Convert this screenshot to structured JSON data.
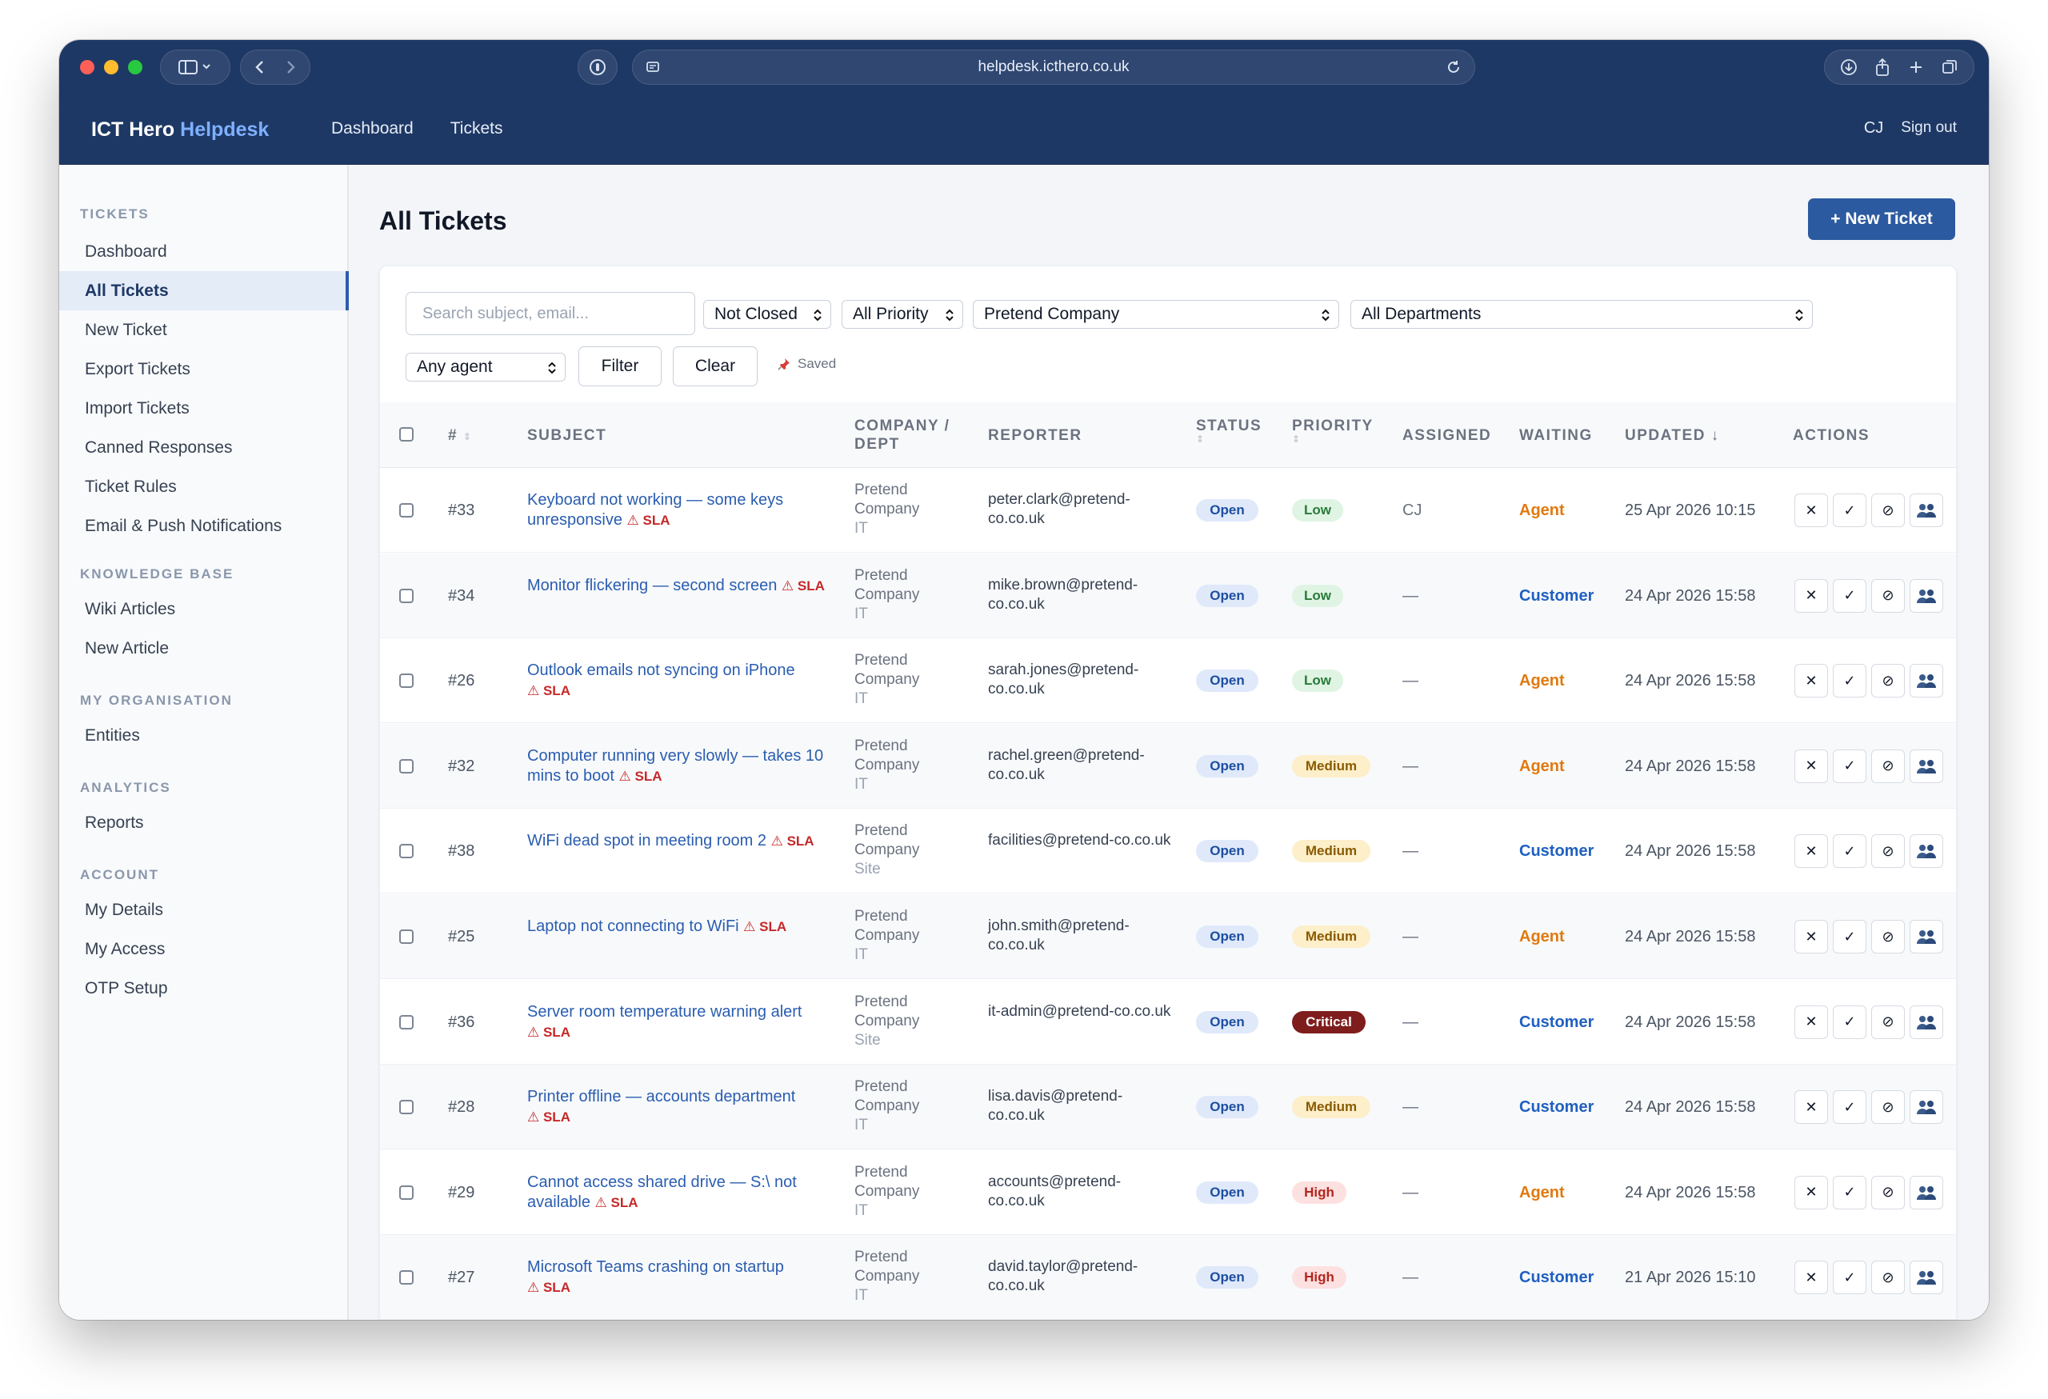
{
  "browser": {
    "url": "helpdesk.icthero.co.uk"
  },
  "header": {
    "brand_main": "ICT Hero",
    "brand_accent": "Helpdesk",
    "nav": [
      {
        "label": "Dashboard"
      },
      {
        "label": "Tickets"
      }
    ],
    "user_initials": "CJ",
    "sign_out": "Sign out"
  },
  "sidebar": {
    "sections": [
      {
        "title": "TICKETS",
        "items": [
          "Dashboard",
          "All Tickets",
          "New Ticket",
          "Export Tickets",
          "Import Tickets",
          "Canned Responses",
          "Ticket Rules",
          "Email & Push Notifications"
        ]
      },
      {
        "title": "KNOWLEDGE BASE",
        "items": [
          "Wiki Articles",
          "New Article"
        ]
      },
      {
        "title": "MY ORGANISATION",
        "items": [
          "Entities"
        ]
      },
      {
        "title": "ANALYTICS",
        "items": [
          "Reports"
        ]
      },
      {
        "title": "ACCOUNT",
        "items": [
          "My Details",
          "My Access",
          "OTP Setup"
        ]
      }
    ],
    "active_item": "All Tickets"
  },
  "main": {
    "title": "All Tickets",
    "new_ticket_label": "+ New Ticket"
  },
  "filters": {
    "search_placeholder": "Search subject, email...",
    "status": "Not Closed",
    "priority": "All Priority",
    "company": "Pretend Company",
    "department": "All Departments",
    "agent": "Any agent",
    "filter_label": "Filter",
    "clear_label": "Clear",
    "saved_label": "Saved"
  },
  "table": {
    "headers": {
      "num": "#",
      "subject": "SUBJECT",
      "company_line1": "COMPANY /",
      "company_line2": "DEPT",
      "reporter": "REPORTER",
      "status": "STATUS",
      "priority": "PRIORITY",
      "assigned": "ASSIGNED",
      "waiting": "WAITING",
      "updated": "UPDATED ↓",
      "actions": "ACTIONS"
    },
    "sla_label": "SLA",
    "rows": [
      {
        "id": "#33",
        "subject": "Keyboard not working — some keys unresponsive",
        "company": "Pretend Company",
        "dept": "IT",
        "reporter": "peter.clark@pretend-co.co.uk",
        "status": "Open",
        "priority": "Low",
        "assigned": "CJ",
        "waiting": "Agent",
        "updated": "25 Apr 2026 10:15"
      },
      {
        "id": "#34",
        "subject": "Monitor flickering — second screen",
        "company": "Pretend Company",
        "dept": "IT",
        "reporter": "mike.brown@pretend-co.co.uk",
        "status": "Open",
        "priority": "Low",
        "assigned": "—",
        "waiting": "Customer",
        "updated": "24 Apr 2026 15:58"
      },
      {
        "id": "#26",
        "subject": "Outlook emails not syncing on iPhone",
        "company": "Pretend Company",
        "dept": "IT",
        "reporter": "sarah.jones@pretend-co.co.uk",
        "status": "Open",
        "priority": "Low",
        "assigned": "—",
        "waiting": "Agent",
        "updated": "24 Apr 2026 15:58"
      },
      {
        "id": "#32",
        "subject": "Computer running very slowly — takes 10 mins to boot",
        "company": "Pretend Company",
        "dept": "IT",
        "reporter": "rachel.green@pretend-co.co.uk",
        "status": "Open",
        "priority": "Medium",
        "assigned": "—",
        "waiting": "Agent",
        "updated": "24 Apr 2026 15:58"
      },
      {
        "id": "#38",
        "subject": "WiFi dead spot in meeting room 2",
        "company": "Pretend Company",
        "dept": "Site",
        "reporter": "facilities@pretend-co.co.uk",
        "status": "Open",
        "priority": "Medium",
        "assigned": "—",
        "waiting": "Customer",
        "updated": "24 Apr 2026 15:58"
      },
      {
        "id": "#25",
        "subject": "Laptop not connecting to WiFi",
        "company": "Pretend Company",
        "dept": "IT",
        "reporter": "john.smith@pretend-co.co.uk",
        "status": "Open",
        "priority": "Medium",
        "assigned": "—",
        "waiting": "Agent",
        "updated": "24 Apr 2026 15:58"
      },
      {
        "id": "#36",
        "subject": "Server room temperature warning alert",
        "company": "Pretend Company",
        "dept": "Site",
        "reporter": "it-admin@pretend-co.co.uk",
        "status": "Open",
        "priority": "Critical",
        "assigned": "—",
        "waiting": "Customer",
        "updated": "24 Apr 2026 15:58"
      },
      {
        "id": "#28",
        "subject": "Printer offline — accounts department",
        "company": "Pretend Company",
        "dept": "IT",
        "reporter": "lisa.davis@pretend-co.co.uk",
        "status": "Open",
        "priority": "Medium",
        "assigned": "—",
        "waiting": "Customer",
        "updated": "24 Apr 2026 15:58"
      },
      {
        "id": "#29",
        "subject": "Cannot access shared drive — S:\\ not available",
        "company": "Pretend Company",
        "dept": "IT",
        "reporter": "accounts@pretend-co.co.uk",
        "status": "Open",
        "priority": "High",
        "assigned": "—",
        "waiting": "Agent",
        "updated": "24 Apr 2026 15:58"
      },
      {
        "id": "#27",
        "subject": "Microsoft Teams crashing on startup",
        "company": "Pretend Company",
        "dept": "IT",
        "reporter": "david.taylor@pretend-co.co.uk",
        "status": "Open",
        "priority": "High",
        "assigned": "—",
        "waiting": "Customer",
        "updated": "21 Apr 2026 15:10"
      }
    ],
    "action_icons": [
      "close-icon",
      "check-icon",
      "ban-icon",
      "assign-users-icon"
    ]
  },
  "colors": {
    "header_bg": "#1e3865",
    "primary_button": "#2c5aa0",
    "link": "#2a5db0",
    "sla_red": "#c62828",
    "waiting_agent": "#e07a10",
    "waiting_customer": "#2060c0"
  }
}
